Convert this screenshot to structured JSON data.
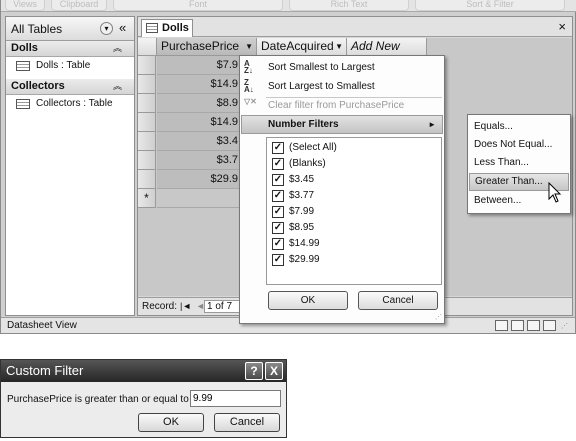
{
  "ribbon": {
    "groups": [
      "Views",
      "Clipboard",
      "Font",
      "Rich Text",
      "Sort & Filter"
    ]
  },
  "nav": {
    "title": "All Tables",
    "menu_icon": "chevron-down-icon",
    "collapse_icon": "double-chevron-left-icon",
    "groups": [
      {
        "name": "Dolls",
        "items": [
          "Dolls : Table"
        ]
      },
      {
        "name": "Collectors",
        "items": [
          "Collectors : Table"
        ]
      }
    ]
  },
  "doc": {
    "tab": "Dolls",
    "close": "×"
  },
  "grid": {
    "columns": [
      "PurchasePrice",
      "DateAcquired",
      "Add New Field"
    ],
    "price_values": [
      "$7.9",
      "$14.9",
      "$8.9",
      "$14.9",
      "$3.4",
      "$3.7",
      "$29.9"
    ],
    "new_row_marker": "*"
  },
  "record_nav": {
    "label": "Record:",
    "first": "|◄",
    "prev": "◄",
    "position": "1 of 7"
  },
  "status": {
    "text": "Datasheet View"
  },
  "filter_menu": {
    "sort_asc": "Sort Smallest to Largest",
    "sort_desc": "Sort Largest to Smallest",
    "clear_filter": "Clear filter from PurchasePrice",
    "number_filters": "Number Filters",
    "checklist": [
      {
        "label": "(Select All)",
        "checked": true
      },
      {
        "label": "(Blanks)",
        "checked": true
      },
      {
        "label": "$3.45",
        "checked": true
      },
      {
        "label": "$3.77",
        "checked": true
      },
      {
        "label": "$7.99",
        "checked": true
      },
      {
        "label": "$8.95",
        "checked": true
      },
      {
        "label": "$14.99",
        "checked": true
      },
      {
        "label": "$29.99",
        "checked": true
      }
    ],
    "ok": "OK",
    "cancel": "Cancel"
  },
  "submenu": {
    "items": [
      "Equals...",
      "Does Not Equal...",
      "Less Than...",
      "Greater Than...",
      "Between..."
    ],
    "highlighted_index": 3
  },
  "dialog": {
    "title": "Custom Filter",
    "help": "?",
    "close": "X",
    "prompt": "PurchasePrice is greater than or equal to",
    "value": "9.99",
    "ok": "OK",
    "cancel": "Cancel"
  }
}
